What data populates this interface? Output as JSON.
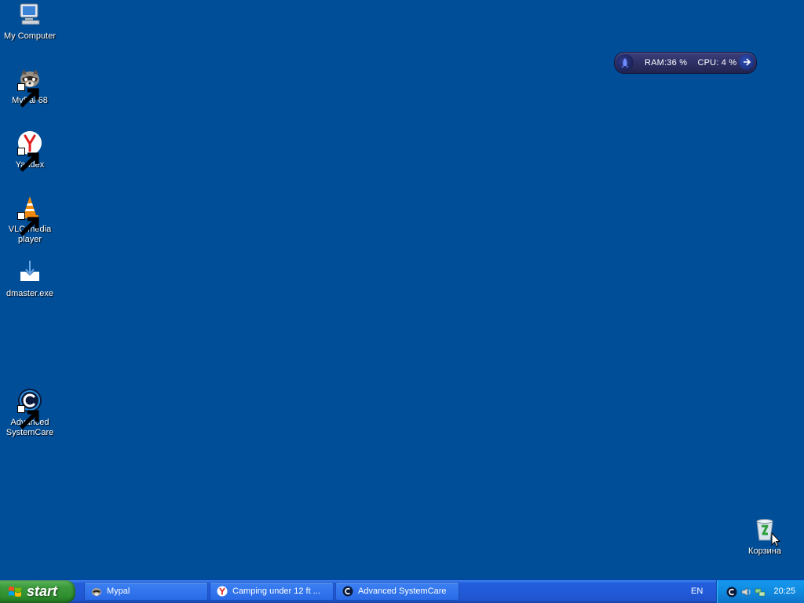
{
  "desktop": {
    "background_color": "#004e98",
    "icons": [
      {
        "label": "My Computer",
        "icon": "computer-icon",
        "shortcut": false
      },
      {
        "label": "MyPal 68",
        "icon": "mypal-raccoon-icon",
        "shortcut": true
      },
      {
        "label": "Yandex",
        "icon": "yandex-icon",
        "shortcut": true
      },
      {
        "label": "VLC media player",
        "icon": "vlc-cone-icon",
        "shortcut": true
      },
      {
        "label": "dmaster.exe",
        "icon": "download-icon",
        "shortcut": false
      },
      {
        "label": "Advanced SystemCare",
        "icon": "advanced-systemcare-icon",
        "shortcut": true
      },
      {
        "label": "Корзина",
        "icon": "recycle-bin-icon",
        "shortcut": false
      }
    ]
  },
  "gadget": {
    "ram_text": "RAM:36 %",
    "cpu_text": "CPU: 4 %",
    "ram_percent": 36,
    "cpu_percent": 4
  },
  "taskbar": {
    "start_label": "start",
    "tasks": [
      {
        "label": "Mypal",
        "icon": "mypal-raccoon-icon"
      },
      {
        "label": "Camping under 12 ft ...",
        "icon": "yandex-icon"
      },
      {
        "label": "Advanced SystemCare",
        "icon": "advanced-systemcare-icon"
      }
    ],
    "language": "EN",
    "tray_icons": [
      "advanced-systemcare-icon",
      "speaker-icon",
      "network-icon"
    ],
    "clock": "20:25",
    "colors": {
      "taskbar_blue": "#245edb",
      "start_green": "#3c9a3c",
      "tray_blue": "#0f8ae0"
    }
  }
}
